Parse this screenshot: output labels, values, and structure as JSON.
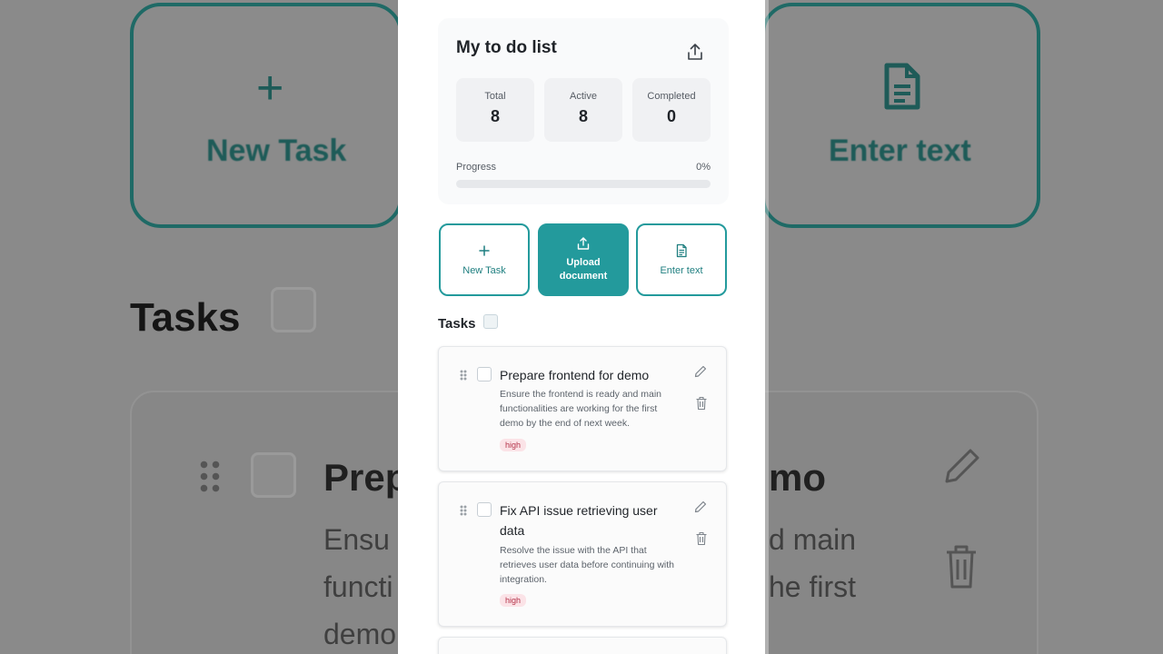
{
  "background": {
    "left_action": "New Task",
    "right_action": "Enter text",
    "tasks_heading": "Tasks",
    "task_title_fragments": [
      "Prep",
      "mo"
    ],
    "desc_fragments_left": [
      "Ensu",
      "functi",
      "demo"
    ],
    "desc_fragments_right": [
      "d main",
      "he first"
    ]
  },
  "summary": {
    "title": "My to do list",
    "stats": [
      {
        "label": "Total",
        "value": "8"
      },
      {
        "label": "Active",
        "value": "8"
      },
      {
        "label": "Completed",
        "value": "0"
      }
    ],
    "progress_label": "Progress",
    "progress_value": "0%",
    "progress_fraction": 0
  },
  "actions": [
    {
      "label": "New Task",
      "icon": "plus-icon"
    },
    {
      "label": "Upload document",
      "icon": "upload-icon"
    },
    {
      "label": "Enter text",
      "icon": "document-icon"
    }
  ],
  "tasks_heading": "Tasks",
  "tasks": [
    {
      "title": "Prepare frontend for demo",
      "description": "Ensure the frontend is ready and main functionalities are working for the first demo by the end of next week.",
      "priority": "high"
    },
    {
      "title": "Fix API issue retrieving user data",
      "description": "Resolve the issue with the API that retrieves user data before continuing with integration.",
      "priority": "high"
    }
  ],
  "colors": {
    "accent": "#239a9c",
    "priority_high_text": "#b4344a",
    "priority_high_bg": "#fbe3e7"
  }
}
